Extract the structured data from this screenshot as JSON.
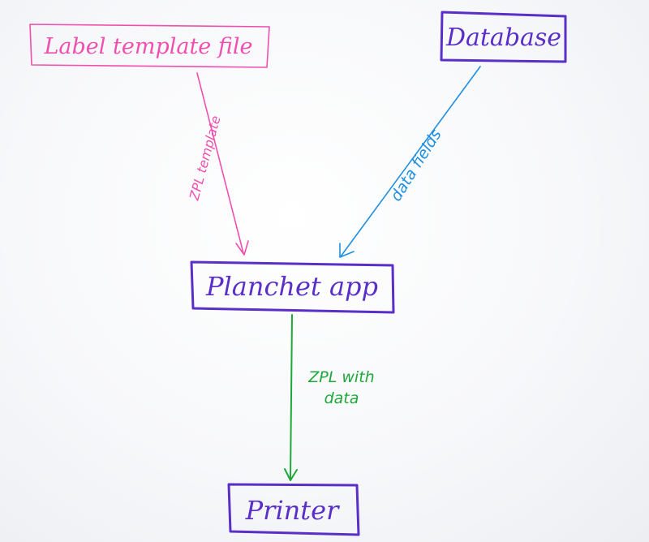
{
  "diagram": {
    "nodes": {
      "label_template_file": {
        "label": "Label template file",
        "color": "#f04fb0"
      },
      "database": {
        "label": "Database",
        "color": "#5a2fc8"
      },
      "planchet_app": {
        "label": "Planchet app",
        "color": "#5a2fc8"
      },
      "printer": {
        "label": "Printer",
        "color": "#5a2fc8"
      }
    },
    "edges": {
      "zpl_template": {
        "label": "ZPL template",
        "color": "#f04fb0"
      },
      "data_fields": {
        "label": "data fields",
        "color": "#1f8fe0"
      },
      "zpl_with_data": {
        "line1": "ZPL with",
        "line2": "data",
        "color": "#1ea83a"
      }
    }
  }
}
